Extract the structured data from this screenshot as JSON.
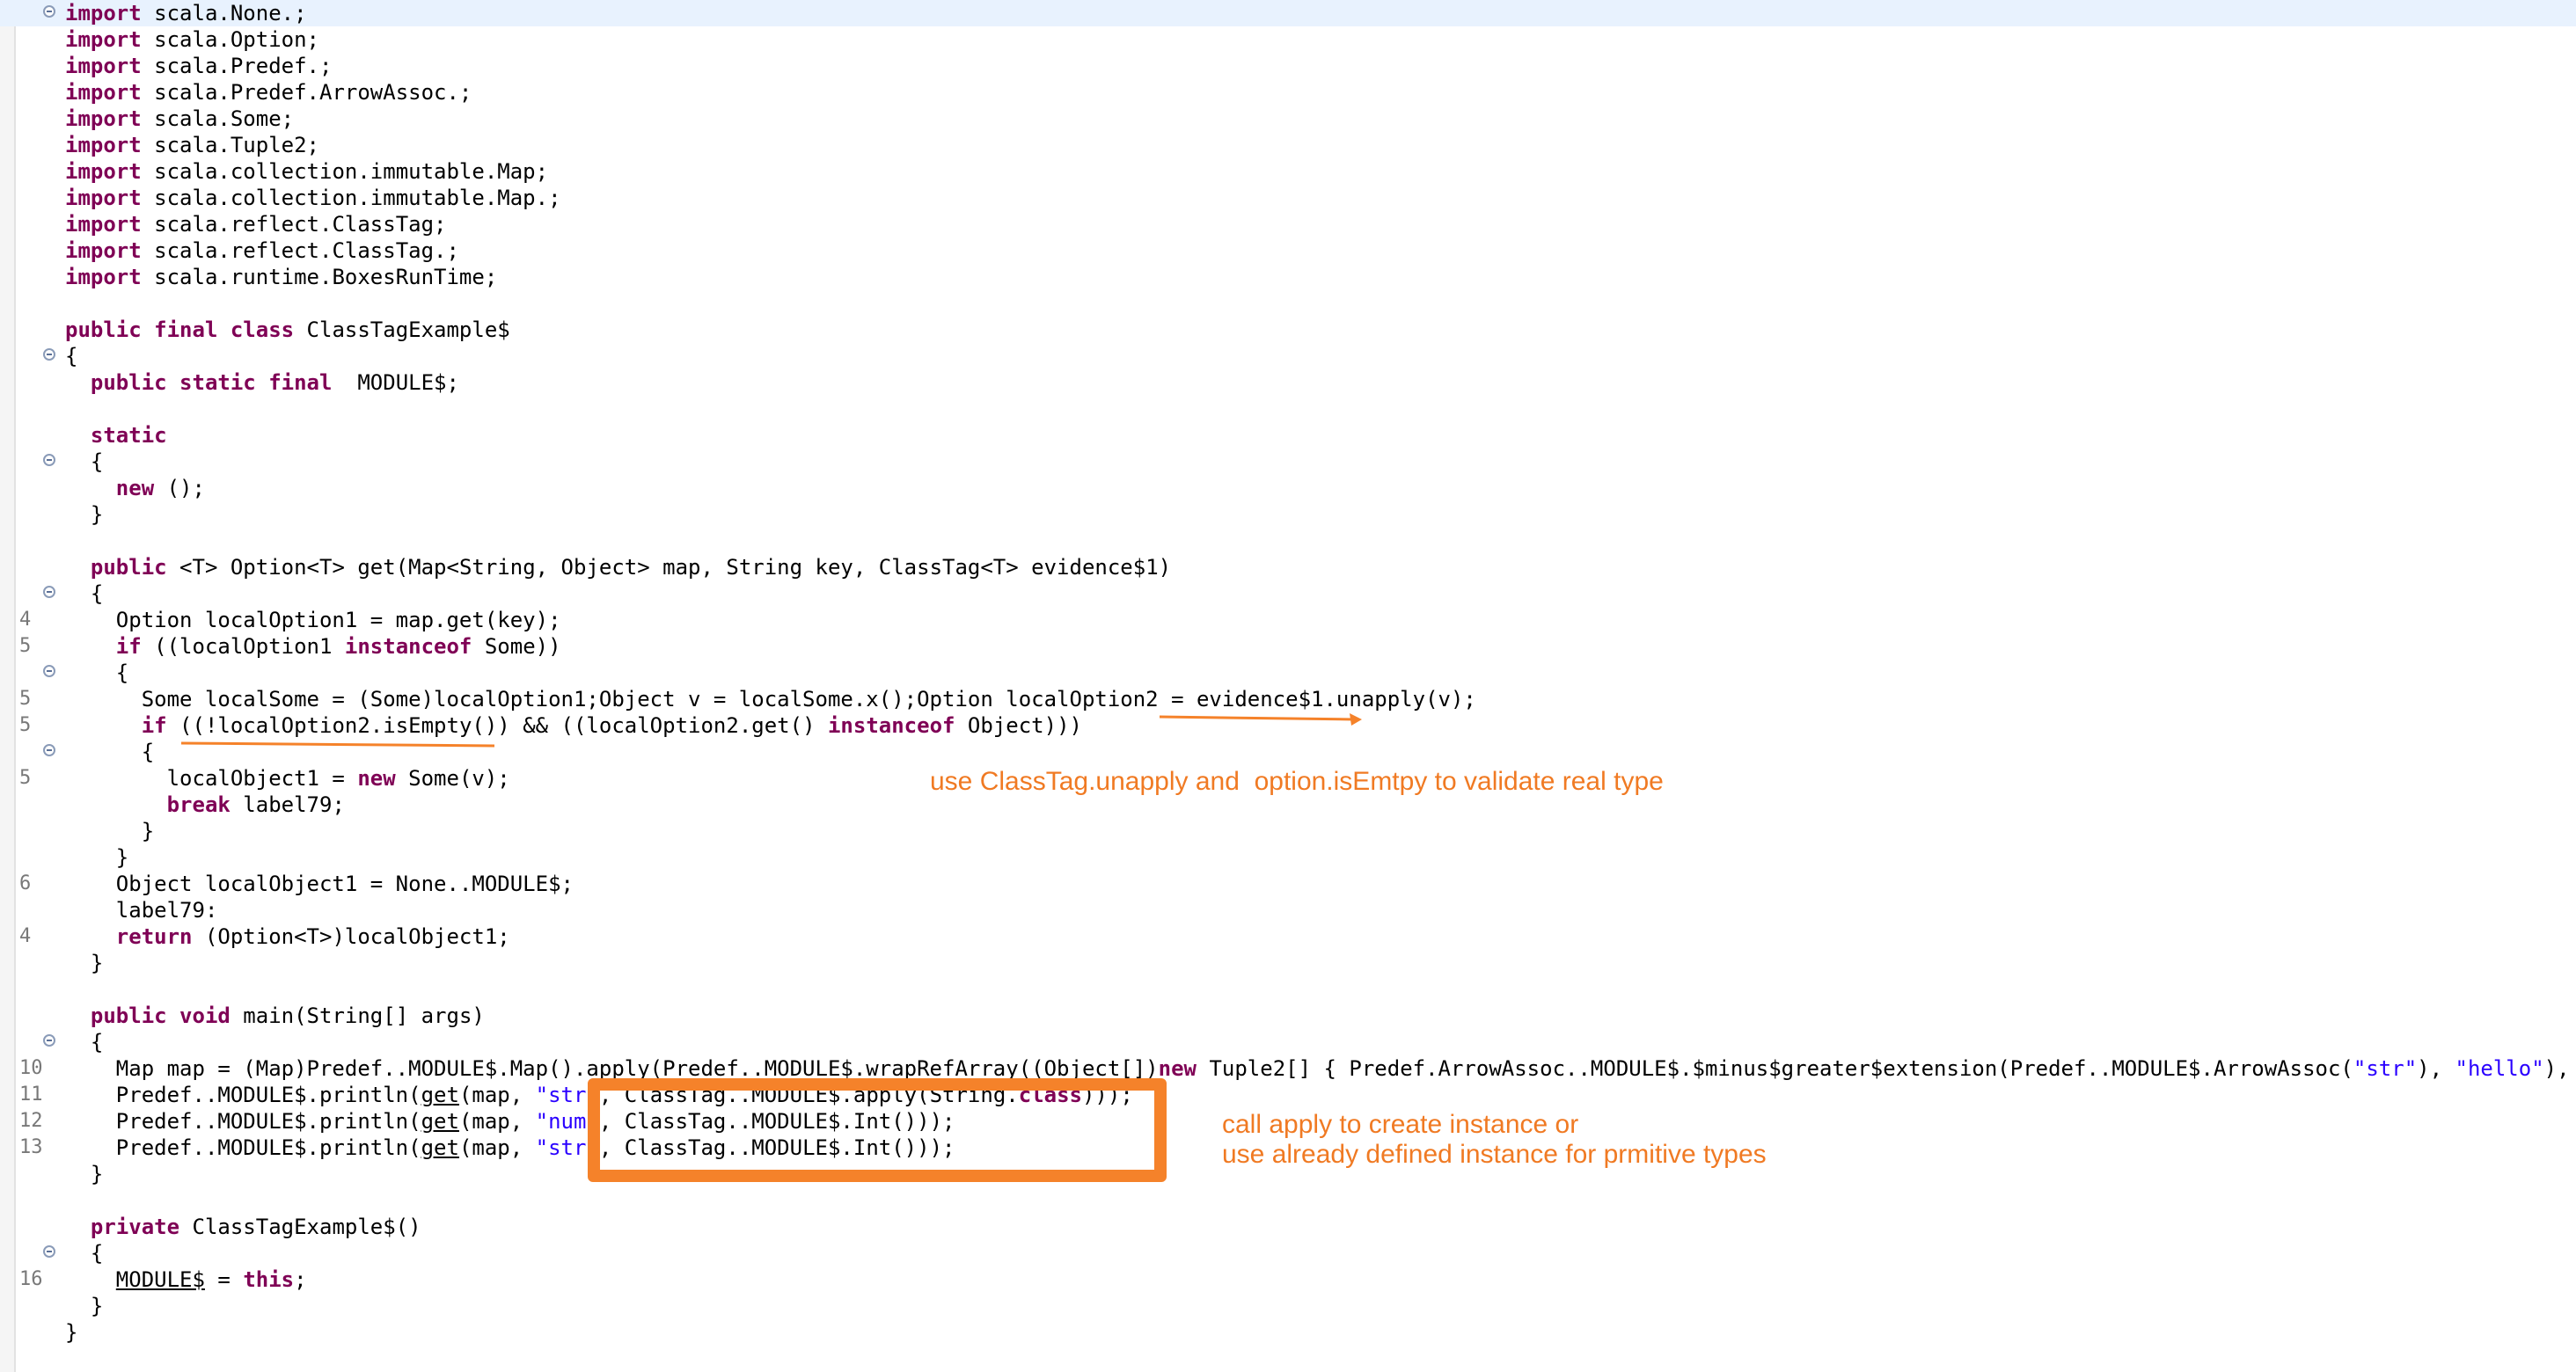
{
  "code_lines": [
    {
      "parts": [
        {
          "t": "import",
          "c": "kw"
        },
        {
          "t": " scala.None.;"
        }
      ]
    },
    {
      "parts": [
        {
          "t": "import",
          "c": "kw"
        },
        {
          "t": " scala.Option;"
        }
      ]
    },
    {
      "parts": [
        {
          "t": "import",
          "c": "kw"
        },
        {
          "t": " scala.Predef.;"
        }
      ]
    },
    {
      "parts": [
        {
          "t": "import",
          "c": "kw"
        },
        {
          "t": " scala.Predef.ArrowAssoc.;"
        }
      ]
    },
    {
      "parts": [
        {
          "t": "import",
          "c": "kw"
        },
        {
          "t": " scala.Some;"
        }
      ]
    },
    {
      "parts": [
        {
          "t": "import",
          "c": "kw"
        },
        {
          "t": " scala.Tuple2;"
        }
      ]
    },
    {
      "parts": [
        {
          "t": "import",
          "c": "kw"
        },
        {
          "t": " scala.collection.immutable.Map;"
        }
      ]
    },
    {
      "parts": [
        {
          "t": "import",
          "c": "kw"
        },
        {
          "t": " scala.collection.immutable.Map.;"
        }
      ]
    },
    {
      "parts": [
        {
          "t": "import",
          "c": "kw"
        },
        {
          "t": " scala.reflect.ClassTag;"
        }
      ]
    },
    {
      "parts": [
        {
          "t": "import",
          "c": "kw"
        },
        {
          "t": " scala.reflect.ClassTag.;"
        }
      ]
    },
    {
      "parts": [
        {
          "t": "import",
          "c": "kw"
        },
        {
          "t": " scala.runtime.BoxesRunTime;"
        }
      ]
    },
    {
      "parts": []
    },
    {
      "parts": [
        {
          "t": "public final class",
          "c": "kw"
        },
        {
          "t": " ClassTagExample$"
        }
      ]
    },
    {
      "parts": [
        {
          "t": "{"
        }
      ]
    },
    {
      "parts": [
        {
          "t": "  "
        },
        {
          "t": "public static final",
          "c": "kw"
        },
        {
          "t": "  MODULE$;"
        }
      ]
    },
    {
      "parts": []
    },
    {
      "parts": [
        {
          "t": "  "
        },
        {
          "t": "static",
          "c": "kw"
        }
      ]
    },
    {
      "parts": [
        {
          "t": "  {"
        }
      ]
    },
    {
      "parts": [
        {
          "t": "    "
        },
        {
          "t": "new",
          "c": "kw"
        },
        {
          "t": " ();"
        }
      ]
    },
    {
      "parts": [
        {
          "t": "  }"
        }
      ]
    },
    {
      "parts": []
    },
    {
      "parts": [
        {
          "t": "  "
        },
        {
          "t": "public",
          "c": "kw"
        },
        {
          "t": " <T> Option<T> get(Map<String, Object> map, String key, ClassTag<T> evidence$1)"
        }
      ]
    },
    {
      "parts": [
        {
          "t": "  {"
        }
      ]
    },
    {
      "parts": [
        {
          "t": "    Option localOption1 = map.get(key);"
        }
      ]
    },
    {
      "parts": [
        {
          "t": "    "
        },
        {
          "t": "if",
          "c": "kw"
        },
        {
          "t": " ((localOption1 "
        },
        {
          "t": "instanceof",
          "c": "kw"
        },
        {
          "t": " Some))"
        }
      ]
    },
    {
      "parts": [
        {
          "t": "    {"
        }
      ]
    },
    {
      "parts": [
        {
          "t": "      Some localSome = (Some)localOption1;Object v = localSome.x();Option localOption2 = evidence$1.unapply(v);"
        }
      ]
    },
    {
      "parts": [
        {
          "t": "      "
        },
        {
          "t": "if",
          "c": "kw"
        },
        {
          "t": " ((!localOption2.isEmpty()) && ((localOption2.get() "
        },
        {
          "t": "instanceof",
          "c": "kw"
        },
        {
          "t": " Object)))"
        }
      ]
    },
    {
      "parts": [
        {
          "t": "      {"
        }
      ]
    },
    {
      "parts": [
        {
          "t": "        localObject1 = "
        },
        {
          "t": "new",
          "c": "kw"
        },
        {
          "t": " Some(v);"
        }
      ]
    },
    {
      "parts": [
        {
          "t": "        "
        },
        {
          "t": "break",
          "c": "kw"
        },
        {
          "t": " label79;"
        }
      ]
    },
    {
      "parts": [
        {
          "t": "      }"
        }
      ]
    },
    {
      "parts": [
        {
          "t": "    }"
        }
      ]
    },
    {
      "parts": [
        {
          "t": "    Object localObject1 = None..MODULE$;"
        }
      ]
    },
    {
      "parts": [
        {
          "t": "    label79:"
        }
      ]
    },
    {
      "parts": [
        {
          "t": "    "
        },
        {
          "t": "return",
          "c": "kw"
        },
        {
          "t": " (Option<T>)localObject1;"
        }
      ]
    },
    {
      "parts": [
        {
          "t": "  }"
        }
      ]
    },
    {
      "parts": []
    },
    {
      "parts": [
        {
          "t": "  "
        },
        {
          "t": "public void",
          "c": "kw"
        },
        {
          "t": " main(String[] args)"
        }
      ]
    },
    {
      "parts": [
        {
          "t": "  {"
        }
      ]
    },
    {
      "parts": [
        {
          "t": "    Map map = (Map)Predef..MODULE$.Map().apply(Predef..MODULE$.wrapRefArray((Object[])"
        },
        {
          "t": "new",
          "c": "kw"
        },
        {
          "t": " Tuple2[] { Predef.ArrowAssoc..MODULE$.$minus$greater$extension(Predef..MODULE$.ArrowAssoc("
        },
        {
          "t": "\"str\"",
          "c": "str"
        },
        {
          "t": "), "
        },
        {
          "t": "\"hello\"",
          "c": "str"
        },
        {
          "t": "), Predef"
        }
      ]
    },
    {
      "parts": [
        {
          "t": "    Predef..MODULE$.println("
        },
        {
          "t": "get",
          "c": "ul"
        },
        {
          "t": "(map, "
        },
        {
          "t": "\"str\"",
          "c": "str"
        },
        {
          "t": ", ClassTag..MODULE$.apply(String."
        },
        {
          "t": "class",
          "c": "kw"
        },
        {
          "t": ")));"
        }
      ]
    },
    {
      "parts": [
        {
          "t": "    Predef..MODULE$.println("
        },
        {
          "t": "get",
          "c": "ul"
        },
        {
          "t": "(map, "
        },
        {
          "t": "\"num\"",
          "c": "str"
        },
        {
          "t": ", ClassTag..MODULE$.Int()));"
        }
      ]
    },
    {
      "parts": [
        {
          "t": "    Predef..MODULE$.println("
        },
        {
          "t": "get",
          "c": "ul"
        },
        {
          "t": "(map, "
        },
        {
          "t": "\"str\"",
          "c": "str"
        },
        {
          "t": ", ClassTag..MODULE$.Int()));"
        }
      ]
    },
    {
      "parts": [
        {
          "t": "  }"
        }
      ]
    },
    {
      "parts": []
    },
    {
      "parts": [
        {
          "t": "  "
        },
        {
          "t": "private",
          "c": "kw"
        },
        {
          "t": " ClassTagExample$()"
        }
      ]
    },
    {
      "parts": [
        {
          "t": "  {"
        }
      ]
    },
    {
      "parts": [
        {
          "t": "    "
        },
        {
          "t": "MODULE$",
          "c": "ul"
        },
        {
          "t": " = "
        },
        {
          "t": "this",
          "c": "kw"
        },
        {
          "t": ";"
        }
      ]
    },
    {
      "parts": [
        {
          "t": "  }"
        }
      ]
    },
    {
      "parts": [
        {
          "t": "}"
        }
      ]
    }
  ],
  "line_numbers": {
    "23": "4",
    "24": "5",
    "26": "5",
    "27": "5",
    "29": "5",
    "33": "6",
    "35": "4",
    "40": "10",
    "41": "11",
    "42": "12",
    "43": "13",
    "48": "16"
  },
  "fold_markers": [
    0,
    13,
    17,
    22,
    25,
    28,
    39,
    47
  ],
  "annotations": {
    "classtag_note": "use ClassTag.unapply and  option.isEmtpy to validate real type",
    "apply_note_line1": "call apply to create instance or",
    "apply_note_line2": "use already defined instance for prmitive types"
  },
  "colors": {
    "keyword": "#7f0055",
    "string": "#2a00ff",
    "annotation": "#f07a23",
    "highlight_box": "#f5822a"
  }
}
